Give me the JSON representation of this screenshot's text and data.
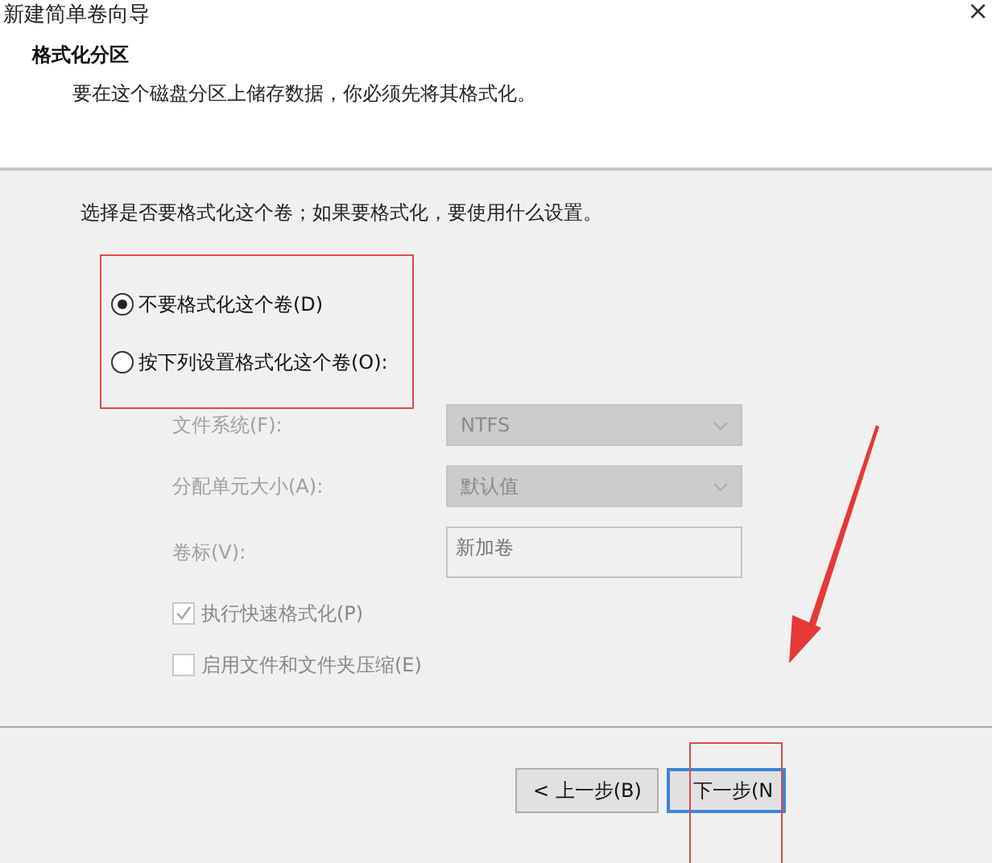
{
  "window": {
    "title": "新建简单卷向导",
    "close": "×"
  },
  "header": {
    "title": "格式化分区",
    "subtitle": "要在这个磁盘分区上储存数据，你必须先将其格式化。"
  },
  "instruction": "选择是否要格式化这个卷；如果要格式化，要使用什么设置。",
  "options": [
    {
      "label": "不要格式化这个卷(D)",
      "selected": true
    },
    {
      "label": "按下列设置格式化这个卷(O):",
      "selected": false
    }
  ],
  "settings": [
    {
      "kind": "select",
      "label": "文件系统(F):",
      "value": "NTFS",
      "disabled": true
    },
    {
      "kind": "select",
      "label": "分配单元大小(A):",
      "value": "默认值",
      "disabled": true
    },
    {
      "kind": "text",
      "label": "卷标(V):",
      "value": "新加卷",
      "disabled": true
    }
  ],
  "checkboxes": [
    {
      "label": "执行快速格式化(P)",
      "checked": true,
      "disabled": true
    },
    {
      "label": "启用文件和文件夹压缩(E)",
      "checked": false,
      "disabled": true
    }
  ],
  "buttons": [
    {
      "label": "< 上一步(B)",
      "focused": false
    },
    {
      "label": "下一步(N",
      "focused": true
    }
  ]
}
